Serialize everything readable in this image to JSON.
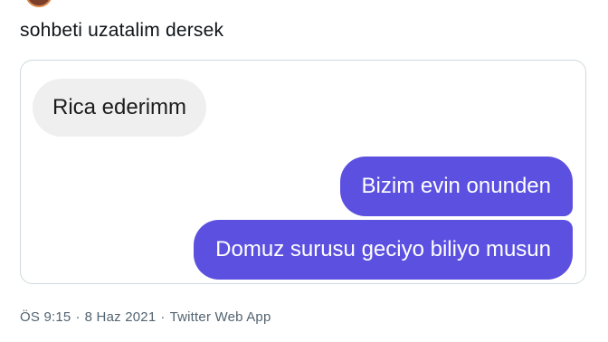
{
  "tweet": {
    "text": "sohbeti uzatalim dersek",
    "time": "ÖS 9:15",
    "separator": "·",
    "date": "8 Haz 2021",
    "source": "Twitter Web App"
  },
  "chat": {
    "messages": [
      {
        "direction": "incoming",
        "text": "Rica ederimm"
      },
      {
        "direction": "outgoing",
        "text": "Bizim evin onunden"
      },
      {
        "direction": "outgoing",
        "text": "Domuz surusu geciyo biliyo musun"
      }
    ]
  },
  "colors": {
    "outgoing_bubble": "#5b50e0",
    "incoming_bubble": "#efefef",
    "meta_text": "#536471",
    "card_border": "#cfd9de"
  }
}
